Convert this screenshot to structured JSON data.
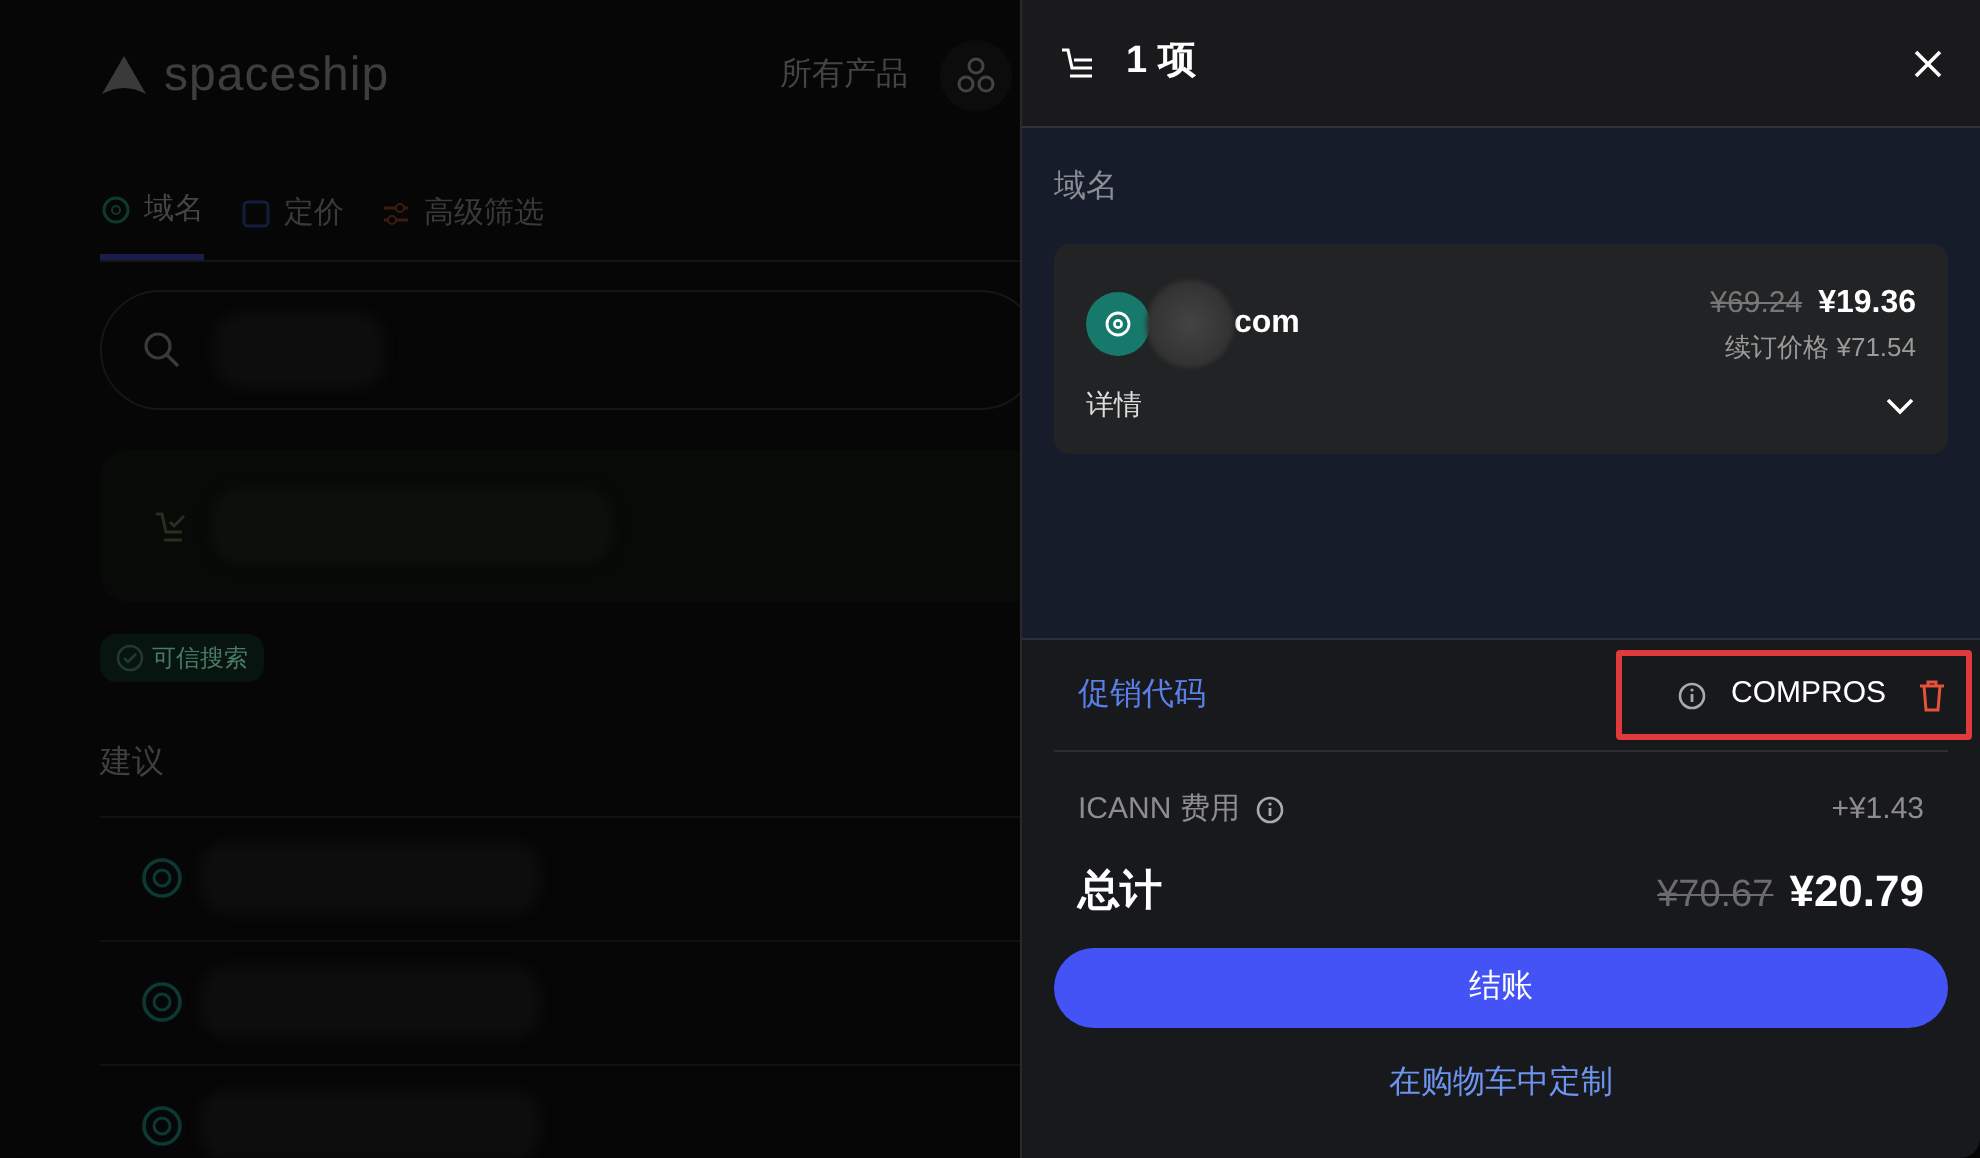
{
  "background_page": {
    "logo": "spaceship",
    "nav": [
      "所有产品"
    ],
    "tabs": [
      {
        "label": "域名",
        "selected": true,
        "kind": "domain"
      },
      {
        "label": "定价",
        "selected": false,
        "kind": "pricing"
      },
      {
        "label": "高级筛选",
        "selected": false,
        "kind": "filter"
      }
    ],
    "badge": "可信搜索",
    "section_title": "建议"
  },
  "cart": {
    "title": "1 项",
    "section_label": "域名",
    "item": {
      "tld": "com",
      "old_price": "¥69.24",
      "price": "¥19.36",
      "renewal": "续订价格 ¥71.54",
      "details_label": "详情",
      "expanded": false
    },
    "promo": {
      "label": "促销代码",
      "code": "COMPROS",
      "highlighted": true
    },
    "fee": {
      "label": "ICANN 费用",
      "amount": "+¥1.43"
    },
    "total": {
      "label": "总计",
      "old_amount": "¥70.67",
      "amount": "¥20.79"
    },
    "checkout_button": "结账",
    "customize_link": "在购物车中定制"
  }
}
